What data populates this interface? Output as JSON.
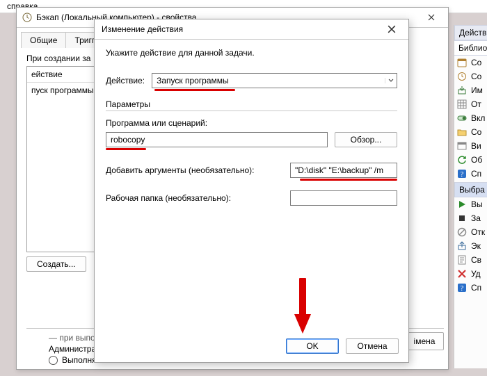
{
  "menu": {
    "help": "справка"
  },
  "props": {
    "title": "Бэкап (Локальный компьютер) - свойства",
    "tabs": {
      "general": "Общие",
      "triggers": "Триггеры"
    },
    "onCreate": "При создании за",
    "col_action": "ействие",
    "row_action": "пуск программы",
    "create_btn": "Создать...",
    "bottom_run": "Выполнять",
    "bottom_admin": "Администратор"
  },
  "dlg": {
    "title": "Изменение действия",
    "hint": "Укажите действие для данной задачи.",
    "action_lbl": "Действие:",
    "action_val": "Запуск программы",
    "params_group": "Параметры",
    "program_lbl": "Программа или сценарий:",
    "program_val": "robocopy",
    "browse": "Обзор...",
    "args_lbl": "Добавить аргументы (необязательно):",
    "args_val": "\"D:\\disk\" \"E:\\backup\" /m",
    "startin_lbl": "Рабочая папка (необязательно):",
    "startin_val": "",
    "ok": "OK",
    "cancel": "Отмена"
  },
  "right": {
    "hdr1": "Действ",
    "hdr2": "Библио",
    "items": [
      {
        "icon": "calendar",
        "label": "Со"
      },
      {
        "icon": "clock",
        "label": "Со"
      },
      {
        "icon": "import",
        "label": "Им"
      },
      {
        "icon": "grid",
        "label": "От"
      },
      {
        "icon": "toggle",
        "label": "Вкл"
      },
      {
        "icon": "folder",
        "label": "Со"
      },
      {
        "icon": "view",
        "label": "Ви"
      },
      {
        "icon": "refresh",
        "label": "Об"
      },
      {
        "icon": "help",
        "label": "Сп"
      }
    ],
    "hdr3": "Выбра",
    "items2": [
      {
        "icon": "play",
        "label": "Вы"
      },
      {
        "icon": "stop",
        "label": "За"
      },
      {
        "icon": "disable",
        "label": "Отк"
      },
      {
        "icon": "export",
        "label": "Эк"
      },
      {
        "icon": "props",
        "label": "Св"
      },
      {
        "icon": "delete",
        "label": "Уд"
      },
      {
        "icon": "help",
        "label": "Сп"
      }
    ]
  },
  "ghost_cancel": "імена"
}
